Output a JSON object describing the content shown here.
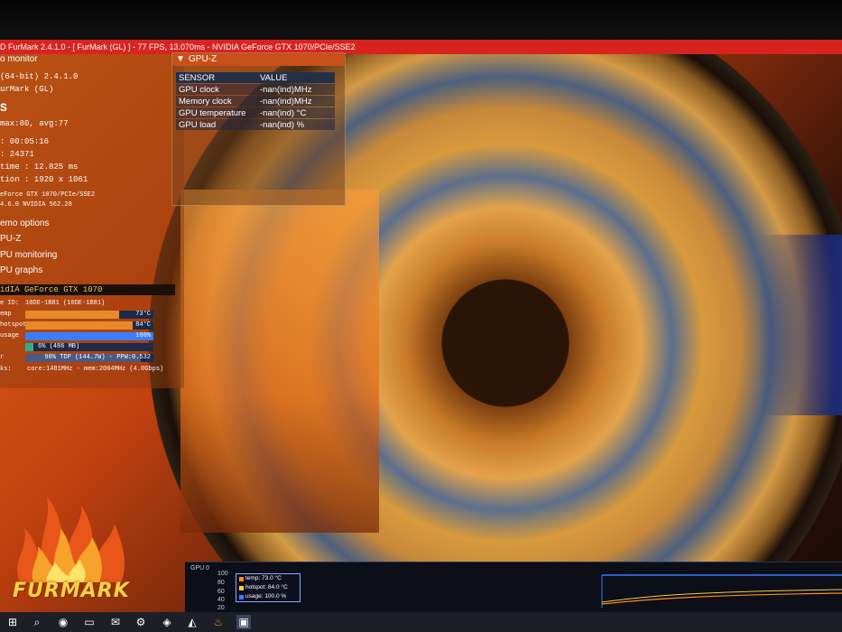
{
  "window": {
    "title": "D FurMark 2.4.1.0 - [ FurMark (GL) ] - 77 FPS, 13.070ms - NVIDIA GeForce GTX 1070/PCIe/SSE2"
  },
  "left_panel": {
    "header": "o monitor",
    "lines": [
      "(64-bit) 2.4.1.0",
      "urMark (GL)",
      "S",
      "max:80, avg:77",
      ": 00:05:16",
      ": 24371",
      "time : 12.825 ms",
      "tion : 1920 x 1061",
      "eForce GTX 1070/PCIe/SSE2",
      "4.6.0 NVIDIA 562.28"
    ],
    "menu": [
      "emo options",
      "PU-Z",
      "PU monitoring",
      "PU graphs"
    ],
    "gpu_header": "idIA GeForce GTX 1070",
    "device_id_label": "e ID:",
    "device_id": "10DE-1B81 (10DE-1B81)",
    "temp_label": "emp",
    "temp": {
      "text": "73°C",
      "fraction": 0.73
    },
    "hotspot_label": "hotspot",
    "hotspot": {
      "text": "84°C",
      "fraction": 0.84
    },
    "usage_label": "usage",
    "usage": {
      "text": "100%",
      "fraction": 1.0
    },
    "mem": {
      "text": "6% (486 MB)",
      "fraction": 0.06
    },
    "power_label": "r",
    "power": {
      "text": "90% TDP (144.7W) - PPW:0.532",
      "fraction": 0.9
    },
    "clocks_label": "ks:",
    "clocks": "core:1481MHz - mem:2004MHz (4.0Gbps)"
  },
  "gpuz": {
    "title": "GPU-Z",
    "col_sensor": "SENSOR",
    "col_value": "VALUE",
    "rows": [
      {
        "sensor": "GPU clock",
        "value": "-nan(ind)MHz"
      },
      {
        "sensor": "Memory clock",
        "value": "-nan(ind)MHz"
      },
      {
        "sensor": "GPU temperature",
        "value": "-nan(ind) °C"
      },
      {
        "sensor": "GPU load",
        "value": "-nan(ind) %"
      }
    ]
  },
  "logo": {
    "text": "FURMARK"
  },
  "graph": {
    "label": "GPU 0",
    "axis": [
      "100",
      "80",
      "60",
      "40",
      "20"
    ],
    "legend": [
      {
        "text": "temp: 73.0 °C",
        "color": "#ff8c1a"
      },
      {
        "text": "hotspot: 84.0 °C",
        "color": "#f0d040"
      },
      {
        "text": "usage: 100.0 %",
        "color": "#3a7dff"
      }
    ]
  },
  "colors": {
    "titlebar": "#d9231f",
    "accent": "#ff8c1a"
  },
  "taskbar": [
    "windows-icon",
    "search-icon",
    "chrome-icon",
    "explorer-icon",
    "mail-icon",
    "steam-icon",
    "gamepad-icon",
    "vlc-icon",
    "furmark-icon",
    "window-icon"
  ]
}
